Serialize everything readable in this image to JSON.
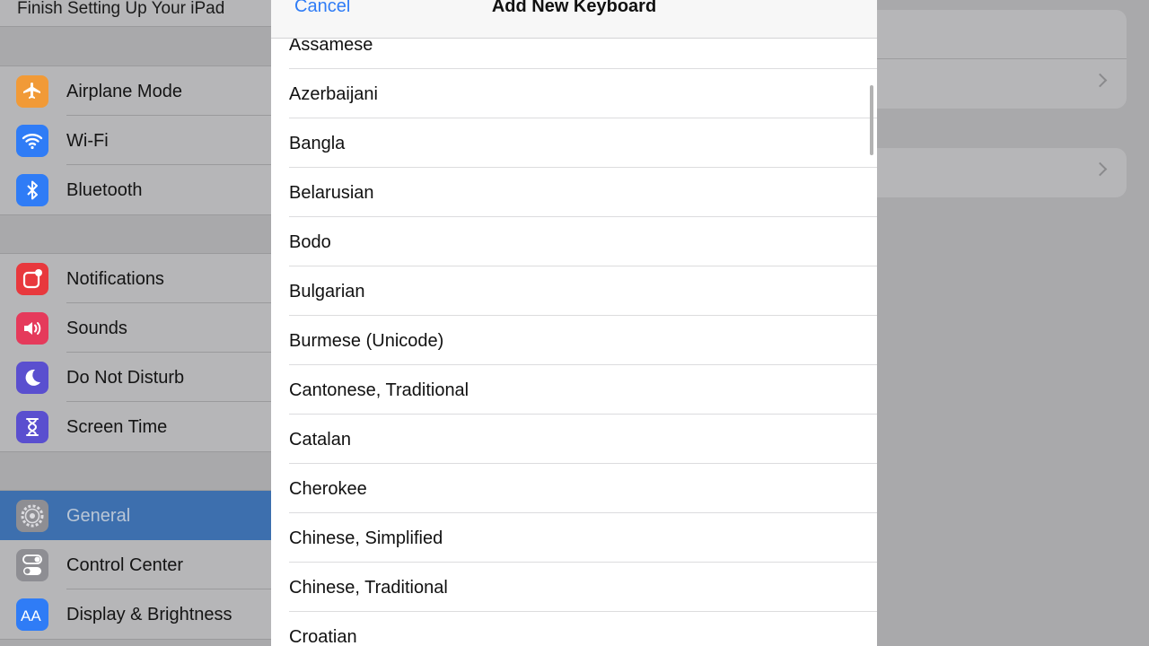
{
  "sidebar": {
    "finish_setup": "Finish Setting Up Your iPad",
    "groups": [
      [
        {
          "label": "Airplane Mode",
          "icon": "airplane-icon",
          "color": "#f19a37"
        },
        {
          "label": "Wi-Fi",
          "icon": "wifi-icon",
          "color": "#2f7cf6"
        },
        {
          "label": "Bluetooth",
          "icon": "bluetooth-icon",
          "color": "#2f7cf6"
        }
      ],
      [
        {
          "label": "Notifications",
          "icon": "notifications-icon",
          "color": "#e8383d"
        },
        {
          "label": "Sounds",
          "icon": "sounds-icon",
          "color": "#e53a5b"
        },
        {
          "label": "Do Not Disturb",
          "icon": "moon-icon",
          "color": "#5a4fcf"
        },
        {
          "label": "Screen Time",
          "icon": "hourglass-icon",
          "color": "#5a4fcf"
        }
      ],
      [
        {
          "label": "General",
          "icon": "gear-icon",
          "color": "#8e8e93",
          "selected": true
        },
        {
          "label": "Control Center",
          "icon": "toggles-icon",
          "color": "#8e8e93"
        },
        {
          "label": "Display & Brightness",
          "icon": "text-size-icon",
          "color": "#2f7cf6"
        }
      ]
    ]
  },
  "modal": {
    "cancel_label": "Cancel",
    "title": "Add New Keyboard",
    "languages": [
      "Assamese",
      "Azerbaijani",
      "Bangla",
      "Belarusian",
      "Bodo",
      "Bulgarian",
      "Burmese (Unicode)",
      "Cantonese, Traditional",
      "Catalan",
      "Cherokee",
      "Chinese, Simplified",
      "Chinese, Traditional",
      "Croatian"
    ]
  },
  "colors": {
    "accent": "#2f7cf6",
    "selected_row": "#3d6fae",
    "dim_background": "#a9a9ab"
  }
}
